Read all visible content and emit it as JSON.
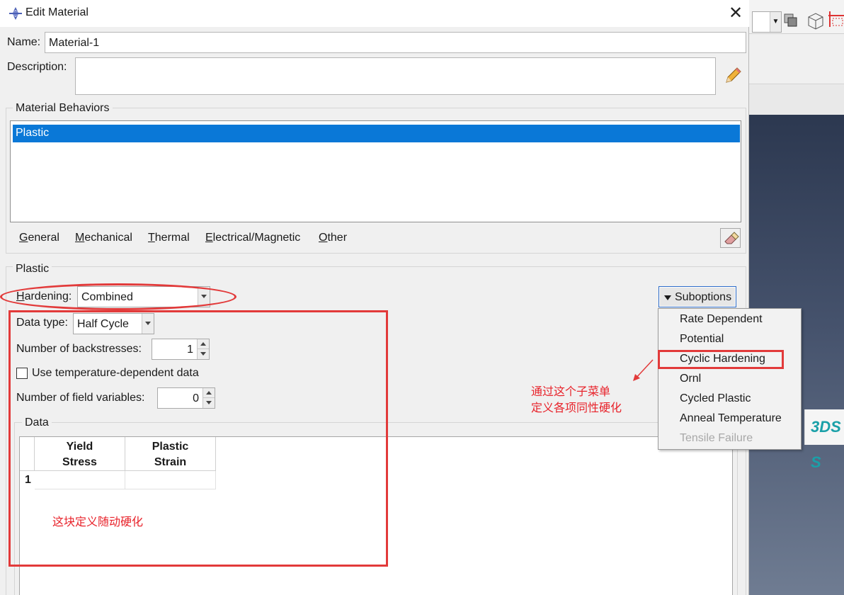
{
  "dialog": {
    "title": "Edit Material",
    "close_glyph": "✕",
    "name_label": "Name:",
    "name_value": "Material-1",
    "description_label": "Description:",
    "description_value": ""
  },
  "material_behaviors": {
    "group_label": "Material Behaviors",
    "items": [
      "Plastic"
    ],
    "menu_tabs": [
      {
        "label": "General",
        "underline": "G"
      },
      {
        "label": "Mechanical",
        "underline": "M"
      },
      {
        "label": "Thermal",
        "underline": "T"
      },
      {
        "label": "Electrical/Magnetic",
        "underline": "E"
      },
      {
        "label": "Other",
        "underline": "O"
      }
    ]
  },
  "plastic": {
    "group_label": "Plastic",
    "hardening_label": "Hardening:",
    "hardening_value": "Combined",
    "suboptions_label": "Suboptions",
    "data_type_label": "Data type:",
    "data_type_value": "Half Cycle",
    "backstresses_label": "Number of backstresses:",
    "backstresses_value": "1",
    "temp_dependent_label": "Use temperature-dependent data",
    "temp_dependent_checked": false,
    "field_vars_label": "Number of field variables:",
    "field_vars_value": "0",
    "data_group_label": "Data",
    "table": {
      "columns": [
        [
          "Yield",
          "Stress"
        ],
        [
          "Plastic",
          "Strain"
        ]
      ],
      "rows": [
        {
          "index": "1",
          "cells": [
            "",
            ""
          ]
        }
      ]
    }
  },
  "suboptions_menu": {
    "items": [
      {
        "label": "Rate Dependent",
        "enabled": true
      },
      {
        "label": "Potential",
        "enabled": true
      },
      {
        "label": "Cyclic Hardening",
        "enabled": true
      },
      {
        "label": "Ornl",
        "enabled": true
      },
      {
        "label": "Cycled Plastic",
        "enabled": true
      },
      {
        "label": "Anneal Temperature",
        "enabled": true
      },
      {
        "label": "Tensile Failure",
        "enabled": false
      }
    ]
  },
  "annotations": {
    "submenu_note_line1": "通过这个子菜单",
    "submenu_note_line2": "定义各项同性硬化",
    "data_note": "这块定义随动硬化",
    "color": "#e23a3a"
  },
  "background_app": {
    "logo_text": "3DS S"
  }
}
